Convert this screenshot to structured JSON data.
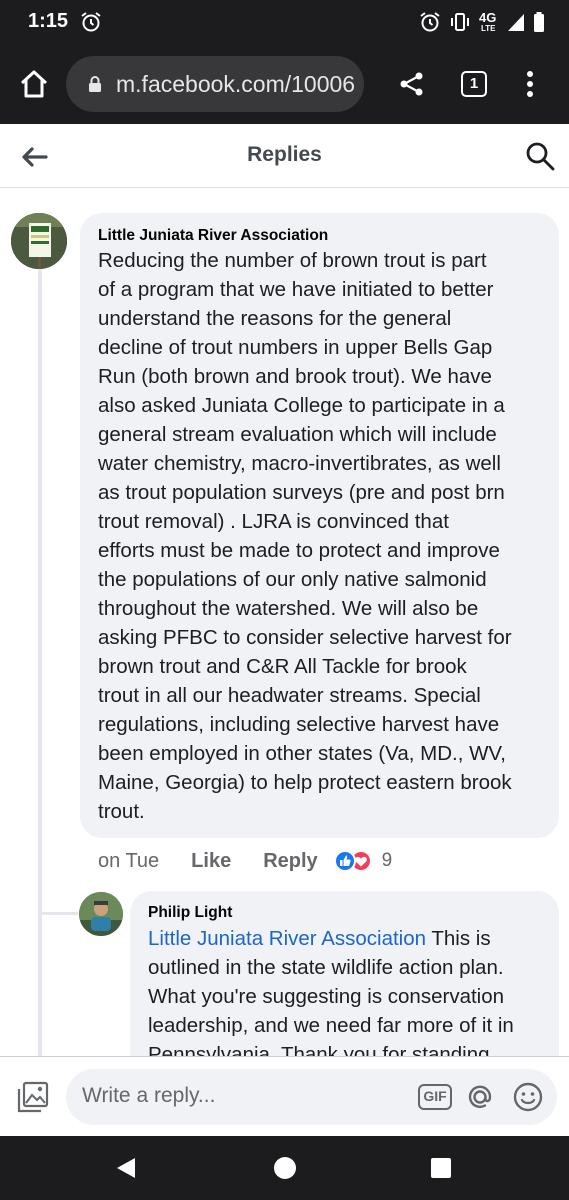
{
  "status_bar": {
    "time": "1:15",
    "network": "4G",
    "network_sub": "LTE",
    "icons": [
      "alarm-icon",
      "vibrate-icon",
      "signal-icon",
      "battery-icon"
    ]
  },
  "browser": {
    "url": "m.facebook.com/10006",
    "tab_count": "1"
  },
  "header": {
    "title": "Replies"
  },
  "comments": [
    {
      "author": "Little Juniata River Association",
      "lines": [
        "Reducing the number of brown trout is part",
        "of a program that we have initiated to better",
        "understand the reasons for the general",
        "decline of trout numbers in upper Bells Gap",
        "Run (both brown and brook trout). We have",
        "also asked Juniata College to participate in a",
        "general stream evaluation which will include",
        "water chemistry, macro-invertibrates, as well",
        "as trout population surveys (pre and post brn",
        "trout removal)  . LJRA is convinced that",
        "efforts must be made to protect and improve",
        "the populations of our only native salmonid",
        "throughout the watershed. We will also be",
        "asking PFBC to consider selective harvest for",
        "brown trout and C&R All Tackle for brook",
        "trout in all our headwater streams. Special",
        "regulations, including selective harvest have",
        "been employed in other states (Va, MD., WV,",
        "Maine, Georgia) to help protect eastern brook",
        "trout."
      ],
      "time": "on Tue",
      "like_label": "Like",
      "reply_label": "Reply",
      "reaction_count": "9"
    },
    {
      "author": "Philip Light",
      "mention": "Little Juniata River Association",
      "first_line_rest": " This is",
      "lines": [
        "outlined in the state wildlife action plan.",
        "What you're suggesting is conservation",
        "leadership, and we need far more of it in",
        "Pennsylvania. Thank you for standing"
      ]
    }
  ],
  "composer": {
    "placeholder": "Write a reply...",
    "gif_label": "GIF"
  },
  "colors": {
    "system_bar": "#1c1c1e",
    "bubble": "#f0f2f5",
    "link": "#1b66c9",
    "like": "#1877f2",
    "love": "#f33e58"
  }
}
